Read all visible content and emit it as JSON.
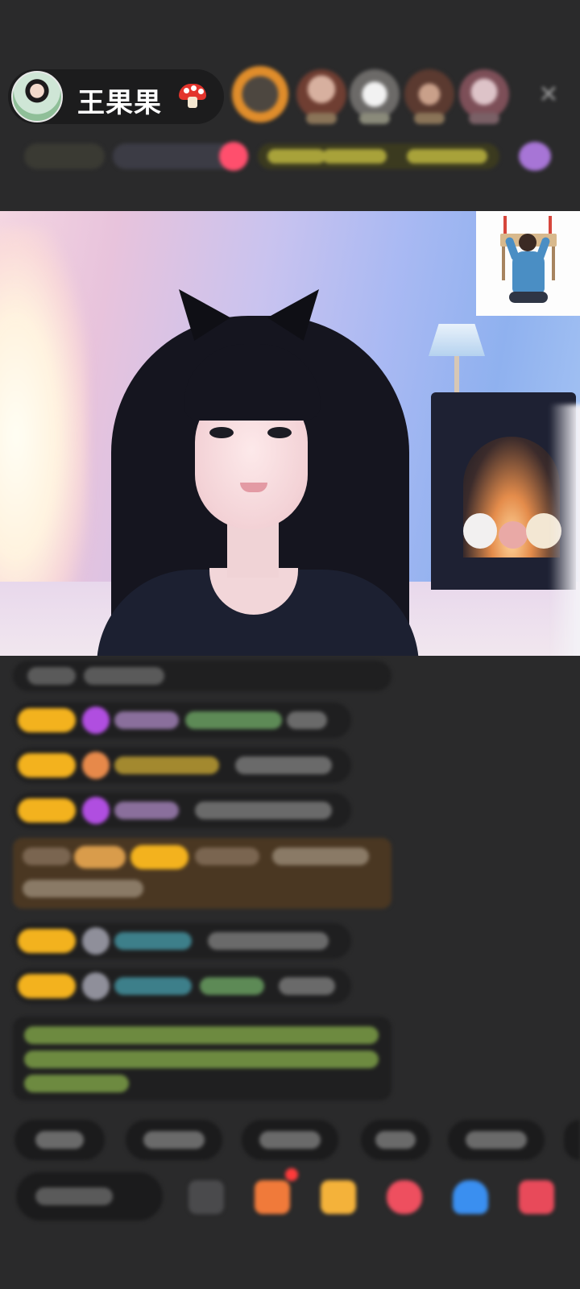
{
  "header": {
    "host_name": "王果果",
    "host_icon": "mushroom-icon",
    "close_label": "✕"
  },
  "colors": {
    "background": "#2a2a2b",
    "level_badge": "#f3b21e",
    "highlight_message": "#4a3722",
    "gift_accent": "#ff4f6d"
  },
  "icons": {
    "host": "mushroom-icon",
    "close": "close-icon",
    "prayer_overlay": "prayer-sticker"
  }
}
